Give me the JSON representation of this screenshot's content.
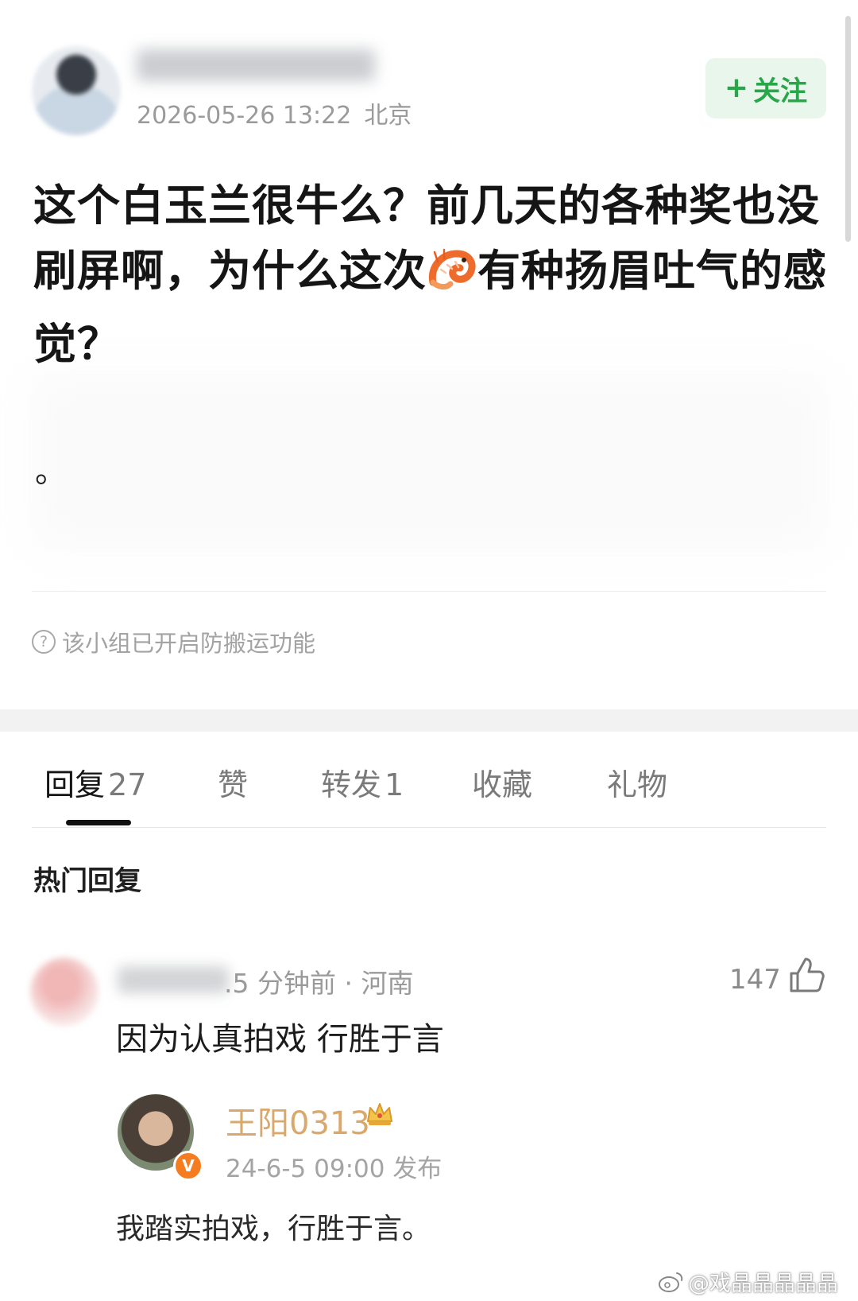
{
  "post": {
    "date": "2026-05-26 13:22",
    "location": "北京",
    "follow_label": "关注",
    "follow_icon": "+",
    "title_before_emoji": "这个白玉兰很牛么？前几天的各种奖也没刷屏啊，为什么这次",
    "title_after_emoji": "有种扬眉吐气的感觉？",
    "emoji_name": "shrimp-icon",
    "extra_text": "。",
    "notice": "该小组已开启防搬运功能",
    "notice_icon": "?"
  },
  "tabs": [
    {
      "label": "回复",
      "count": "27"
    },
    {
      "label": "赞",
      "count": ""
    },
    {
      "label": "转发",
      "count": "1"
    },
    {
      "label": "收藏",
      "count": ""
    },
    {
      "label": "礼物",
      "count": ""
    }
  ],
  "section_title": "热门回复",
  "comment": {
    "meta": ".5 分钟前 · 河南",
    "likes": "147",
    "text": "因为认真拍戏 行胜于言",
    "quote": {
      "name": "王阳0313",
      "verified_mark": "V",
      "meta": "24-6-5 09:00  发布",
      "text": "我踏实拍戏，行胜于言。"
    }
  },
  "watermark": "@戏晶晶晶晶晶",
  "colors": {
    "accent_green": "#2aa64a",
    "follow_bg": "#e8f6ec",
    "name_gold": "#d9a86a",
    "verified_orange": "#f57c1f"
  }
}
